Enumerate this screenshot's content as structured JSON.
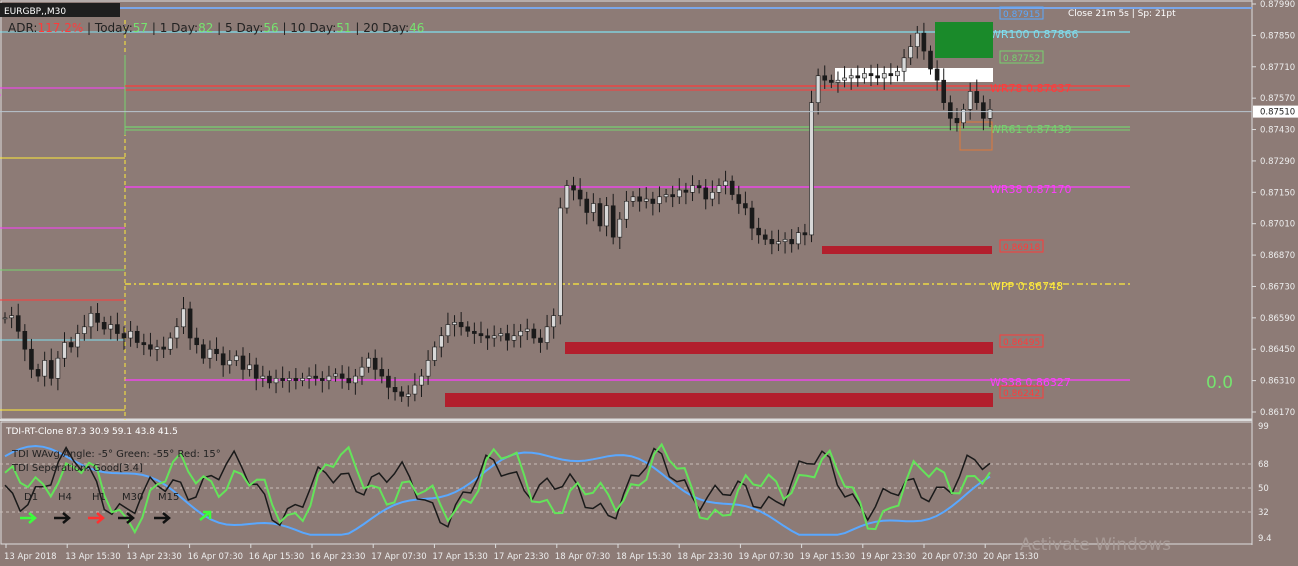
{
  "window": {
    "title": "EURGBP,,M30",
    "close_text": "Close 21m 5s | Sp: 21pt"
  },
  "adr": {
    "label": "ADR:",
    "value": "117.2%",
    "items": [
      {
        "label": "Today:",
        "value": "57"
      },
      {
        "label": "1 Day:",
        "value": "82"
      },
      {
        "label": "5 Day:",
        "value": "56"
      },
      {
        "label": "10 Day:",
        "value": "51"
      },
      {
        "label": "20 Day:",
        "value": "46"
      }
    ]
  },
  "right_value": "0.0",
  "watermark": "Activate Windows",
  "indicator": {
    "title": "TDI-RT-Clone 87.3 30.9 59.1 43.8 41.5",
    "line2": "TDI WAvg Angle: -5°  Green: -55°  Red: 15°",
    "line3": "TDI Seperation: Good[3.4]",
    "tf_labels": [
      "D1",
      "H4",
      "H1",
      "M30",
      "M15"
    ],
    "levels": [
      "99",
      "68",
      "50",
      "32",
      "9.4"
    ]
  },
  "colors": {
    "background": "#8d7b76",
    "candle": "#1a1a1a",
    "green_zone": "#1a8a2a",
    "red_zone": "#b21f2d",
    "cyan": "#7fdff0",
    "magenta": "#ff3cff",
    "red_line": "#ff3b3b",
    "green_line": "#76d36f",
    "yellow": "#ffeb3b",
    "blue_line": "#5aa8ff",
    "green_tdi": "#64e35a"
  },
  "chart_data": {
    "type": "candlestick",
    "symbol": "EURGBP",
    "timeframe": "M30",
    "ylim": [
      0.8617,
      0.8799
    ],
    "price_ticks": [
      "0.87990",
      "0.87850",
      "0.87710",
      "0.87570",
      "0.87430",
      "0.87290",
      "0.87150",
      "0.87010",
      "0.86870",
      "0.86730",
      "0.86590",
      "0.86450",
      "0.86310",
      "0.86170"
    ],
    "current_price": "0.87510",
    "x_labels": [
      "13 Apr 2018",
      "13 Apr 15:30",
      "13 Apr 23:30",
      "16 Apr 07:30",
      "16 Apr 15:30",
      "16 Apr 23:30",
      "17 Apr 07:30",
      "17 Apr 15:30",
      "17 Apr 23:30",
      "18 Apr 07:30",
      "18 Apr 15:30",
      "18 Apr 23:30",
      "19 Apr 07:30",
      "19 Apr 15:30",
      "19 Apr 23:30",
      "20 Apr 07:30",
      "20 Apr 15:30"
    ],
    "levels": [
      {
        "label": "WR100",
        "price": 0.87866,
        "text": "WR100  0.87866",
        "color": "#7fdff0"
      },
      {
        "label": "WR78",
        "price": 0.87637,
        "text": "WR78  0.87637",
        "color": "#ff3b3b"
      },
      {
        "label": "WR61",
        "price": 0.87439,
        "text": "WR61  0.87439",
        "color": "#76d36f"
      },
      {
        "label": "WR38",
        "price": 0.8717,
        "text": "WR38  0.87170",
        "color": "#ff3cff"
      },
      {
        "label": "WPP",
        "price": 0.86748,
        "text": "WPP  0.86748",
        "color": "#ffeb3b"
      },
      {
        "label": "WS38",
        "price": 0.86327,
        "text": "WS38  0.86327",
        "color": "#ff3cff"
      }
    ],
    "zone_labels": [
      {
        "text": "0.87915",
        "color": "#5aa8ff",
        "price": 0.87915
      },
      {
        "text": "0.87752",
        "color": "#76d36f",
        "price": 0.87752
      },
      {
        "text": "0.86918",
        "color": "#ff3b3b",
        "price": 0.86918
      },
      {
        "text": "0.86495",
        "color": "#ff3b3b",
        "price": 0.86495
      },
      {
        "text": "0.86242",
        "color": "#ff3b3b",
        "price": 0.86242
      }
    ],
    "ohlc_path": [
      0.8659,
      0.866,
      0.8653,
      0.8645,
      0.8636,
      0.8633,
      0.864,
      0.8632,
      0.8641,
      0.8648,
      0.8646,
      0.8652,
      0.8655,
      0.8661,
      0.8657,
      0.8654,
      0.8656,
      0.8652,
      0.865,
      0.8653,
      0.8648,
      0.8647,
      0.8645,
      0.8646,
      0.8645,
      0.865,
      0.8655,
      0.8663,
      0.865,
      0.8647,
      0.8641,
      0.8645,
      0.8643,
      0.8638,
      0.864,
      0.8642,
      0.8636,
      0.8638,
      0.8632,
      0.8633,
      0.863,
      0.8632,
      0.8631,
      0.8632,
      0.8631,
      0.8632,
      0.8633,
      0.8632,
      0.8631,
      0.8633,
      0.8634,
      0.8632,
      0.863,
      0.8633,
      0.8637,
      0.8641,
      0.8636,
      0.8633,
      0.8628,
      0.8626,
      0.8624,
      0.8625,
      0.8629,
      0.8633,
      0.864,
      0.8646,
      0.8651,
      0.8656,
      0.8657,
      0.8655,
      0.8653,
      0.8652,
      0.8651,
      0.865,
      0.8651,
      0.8652,
      0.8649,
      0.8651,
      0.8653,
      0.8654,
      0.865,
      0.8648,
      0.8655,
      0.866,
      0.8708,
      0.8718,
      0.8716,
      0.8712,
      0.8706,
      0.871,
      0.87,
      0.8709,
      0.8695,
      0.8703,
      0.8711,
      0.8713,
      0.8711,
      0.8712,
      0.871,
      0.8713,
      0.8714,
      0.8713,
      0.8716,
      0.8715,
      0.8718,
      0.8717,
      0.8712,
      0.8715,
      0.8718,
      0.872,
      0.8714,
      0.871,
      0.8708,
      0.8699,
      0.8696,
      0.8694,
      0.8692,
      0.8693,
      0.8694,
      0.8692,
      0.8697,
      0.8696,
      0.8755,
      0.8767,
      0.8765,
      0.8764,
      0.8765,
      0.8766,
      0.8767,
      0.8766,
      0.8768,
      0.8767,
      0.8766,
      0.8768,
      0.8767,
      0.8769,
      0.8775,
      0.878,
      0.8786,
      0.8778,
      0.877,
      0.8765,
      0.8755,
      0.8748,
      0.8746,
      0.8752,
      0.876,
      0.8755,
      0.8748,
      0.8752
    ]
  }
}
